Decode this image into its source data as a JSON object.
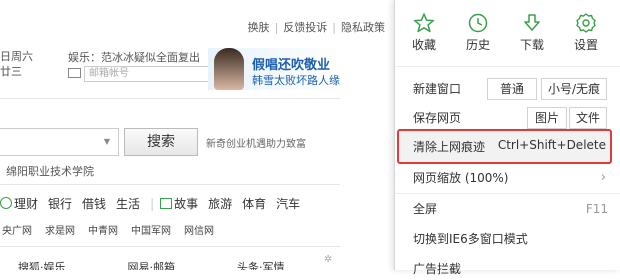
{
  "page": {
    "topnav": [
      "换肤",
      "反馈投诉",
      "隐私政策"
    ],
    "date_line1": "日周六",
    "date_line2": "廿三",
    "news": "娱乐：范冰冰疑似全面复出",
    "mail_placeholder": "邮箱帐号",
    "ad_title": "假唱还吹敬业",
    "ad_sub": "韩雪太败坏路人缘",
    "search_button": "搜索",
    "search_hint": "新奇创业机遇助力致富",
    "school": "绵阳职业技术学院",
    "categories": [
      "理财",
      "银行",
      "借钱",
      "生活",
      "故事",
      "旅游",
      "体育",
      "汽车"
    ],
    "links": [
      "央广网",
      "求是网",
      "中青网",
      "中国军网",
      "网信网"
    ],
    "bottom_tabs": [
      "搜狐·娱乐",
      "网易·邮箱",
      "头条·军情"
    ]
  },
  "menu": {
    "quick": [
      {
        "label": "收藏",
        "icon": "star-icon"
      },
      {
        "label": "历史",
        "icon": "clock-icon"
      },
      {
        "label": "下载",
        "icon": "download-icon"
      },
      {
        "label": "设置",
        "icon": "gear-icon"
      }
    ],
    "new_window": "新建窗口",
    "normal": "普通",
    "small_private": "小号/无痕",
    "save_page": "保存网页",
    "picture": "图片",
    "file": "文件",
    "clear_trace": "清除上网痕迹",
    "clear_shortcut": "Ctrl+Shift+Delete",
    "zoom": "网页缩放 (100%)",
    "zoom_arrow": "›",
    "fullscreen": "全屏",
    "fullscreen_key": "F11",
    "ie6_mode": "切换到IE6多窗口模式",
    "ad_block": "广告拦截"
  },
  "colors": {
    "accent_green": "#3aa04a",
    "highlight_red": "#e03b3b",
    "ad_blue": "#1d5fae"
  }
}
